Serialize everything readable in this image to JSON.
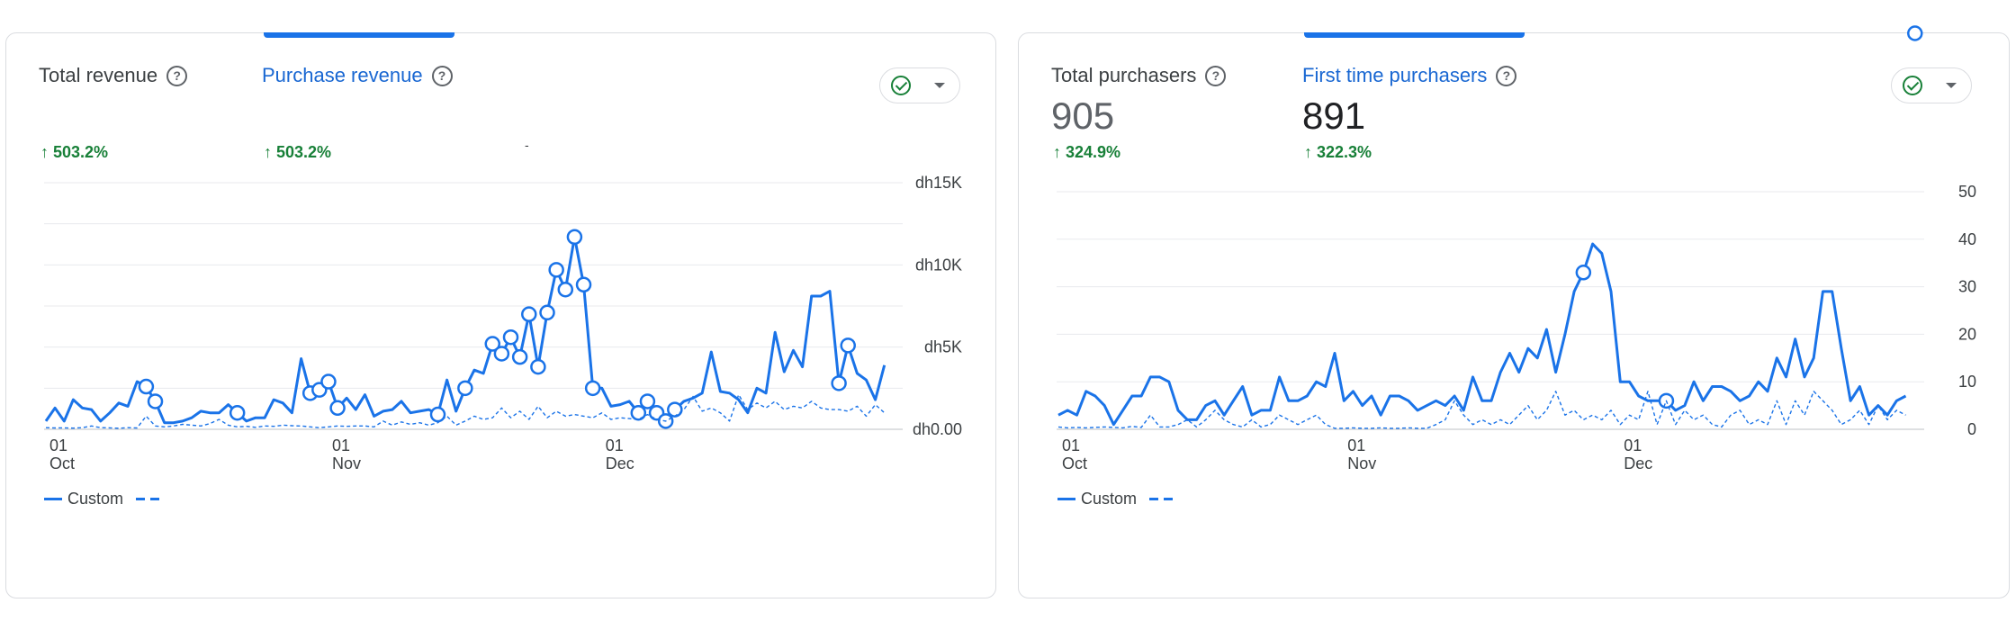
{
  "cards": [
    {
      "metrics": [
        {
          "label": "Total revenue",
          "value": "",
          "change": "503.2%"
        },
        {
          "label": "Purchase revenue",
          "value": "",
          "change": "503.2%"
        }
      ],
      "dash": "-",
      "legend": {
        "label": "Custom"
      }
    },
    {
      "metrics": [
        {
          "label": "Total purchasers",
          "value": "905",
          "change": "324.9%"
        },
        {
          "label": "First time purchasers",
          "value": "891",
          "change": "322.3%"
        }
      ],
      "dash": "",
      "legend": {
        "label": "Custom"
      }
    }
  ],
  "colors": {
    "series": "#1a73e8",
    "positive": "#188038",
    "grid": "#e8eaed"
  },
  "icons": {
    "help": "help-circle-icon",
    "status": "check-circle-icon",
    "dropdown": "caret-down-icon"
  },
  "chart_data": [
    {
      "type": "line",
      "ylim": [
        0,
        15000
      ],
      "y_ticks": [
        "dh0.00",
        "dh5K",
        "dh10K",
        "dh15K"
      ],
      "y_tick_values": [
        0,
        5000,
        10000,
        15000
      ],
      "x_ticks": [
        {
          "day": 1,
          "label": "01",
          "sub": "Oct"
        },
        {
          "day": 32,
          "label": "01",
          "sub": "Nov"
        },
        {
          "day": 62,
          "label": "01",
          "sub": "Dec"
        }
      ],
      "x_domain": [
        1,
        95
      ],
      "series": [
        {
          "name": "Custom",
          "style": "solid",
          "values": [
            500,
            1300,
            500,
            1800,
            1300,
            1200,
            500,
            1000,
            1600,
            1400,
            2900,
            2600,
            1700,
            400,
            400,
            500,
            700,
            1100,
            1000,
            1000,
            1500,
            1000,
            500,
            700,
            700,
            1800,
            1600,
            1000,
            4300,
            2200,
            2400,
            2900,
            1300,
            1900,
            1200,
            2100,
            800,
            1100,
            1200,
            1700,
            1000,
            1100,
            1200,
            900,
            3000,
            1100,
            2500,
            3600,
            3400,
            5200,
            4600,
            5600,
            4400,
            7000,
            3800,
            7100,
            9700,
            8500,
            11700,
            8800,
            2500,
            2500,
            1400,
            1500,
            1700,
            1000,
            1700,
            1000,
            500,
            1200,
            1700,
            1900,
            2200,
            4700,
            2300,
            2200,
            1800,
            1000,
            2500,
            2200,
            5900,
            3500,
            4800,
            3800,
            8100,
            8100,
            8400,
            2800,
            5100,
            3400,
            3000,
            1800,
            3900
          ],
          "markers": [
            11,
            12,
            21,
            29,
            30,
            31,
            32,
            43,
            46,
            49,
            50,
            51,
            52,
            53,
            54,
            55,
            56,
            57,
            58,
            59,
            60,
            65,
            66,
            67,
            68,
            69,
            87,
            88
          ]
        },
        {
          "name": "",
          "style": "dashed",
          "values": [
            100,
            80,
            90,
            70,
            100,
            200,
            100,
            90,
            60,
            100,
            80,
            800,
            200,
            150,
            200,
            300,
            250,
            200,
            350,
            600,
            250,
            150,
            180,
            120,
            200,
            180,
            250,
            220,
            200,
            150,
            100,
            150,
            200,
            180,
            200,
            200,
            150,
            500,
            250,
            450,
            300,
            400,
            250,
            400,
            800,
            250,
            500,
            800,
            600,
            700,
            1300,
            700,
            1100,
            600,
            1400,
            700,
            1100,
            800,
            900,
            800,
            700,
            1000,
            600,
            700,
            650,
            600,
            900,
            600,
            500,
            800,
            1200,
            2000,
            1100,
            1300,
            1000,
            500,
            2100,
            1200,
            1600,
            1300,
            1700,
            1200,
            1400,
            1300,
            1700,
            1300,
            1200,
            1200,
            1100,
            1400,
            800,
            1500,
            1000
          ]
        }
      ]
    },
    {
      "type": "line",
      "ylim": [
        0,
        50
      ],
      "y_ticks": [
        "0",
        "10",
        "20",
        "30",
        "40",
        "50"
      ],
      "y_tick_values": [
        0,
        10,
        20,
        30,
        40,
        50
      ],
      "x_ticks": [
        {
          "day": 1,
          "label": "01",
          "sub": "Oct"
        },
        {
          "day": 32,
          "label": "01",
          "sub": "Nov"
        },
        {
          "day": 62,
          "label": "01",
          "sub": "Dec"
        }
      ],
      "x_domain": [
        1,
        95
      ],
      "series": [
        {
          "name": "Custom",
          "style": "solid",
          "values": [
            3,
            4,
            3,
            8,
            7,
            5,
            1,
            4,
            7,
            7,
            11,
            11,
            10,
            4,
            2,
            2,
            5,
            6,
            3,
            6,
            9,
            3,
            4,
            4,
            11,
            6,
            6,
            7,
            10,
            9,
            16,
            6,
            8,
            5,
            7,
            3,
            7,
            7,
            6,
            4,
            5,
            6,
            5,
            7,
            4,
            11,
            6,
            6,
            12,
            16,
            12,
            17,
            15,
            21,
            12,
            20,
            29,
            33,
            39,
            37,
            29,
            10,
            10,
            7,
            6,
            6,
            6,
            4,
            5,
            10,
            6,
            9,
            9,
            8,
            6,
            7,
            10,
            8,
            15,
            11,
            19,
            11,
            15,
            29,
            29,
            17,
            6,
            9,
            3,
            5,
            3,
            6,
            7
          ],
          "markers": [
            57,
            66,
            93
          ]
        },
        {
          "name": "",
          "style": "dashed",
          "values": [
            0.5,
            0.3,
            0.4,
            0.3,
            0.4,
            0.5,
            0.4,
            0.3,
            0.6,
            0.4,
            3,
            0.5,
            0.5,
            1,
            2,
            0.5,
            2,
            4,
            2,
            1,
            0.5,
            2,
            0.5,
            1,
            3,
            2,
            1,
            2,
            3,
            1,
            0.2,
            0.2,
            0.3,
            0.2,
            0.2,
            0.3,
            0.2,
            0.2,
            0.3,
            0.2,
            0.2,
            1,
            2,
            6,
            3,
            1,
            2,
            1,
            2,
            1,
            3,
            5,
            2,
            4,
            8,
            3,
            4,
            2,
            3,
            2,
            4,
            1,
            3,
            2,
            8,
            1,
            6,
            1,
            4,
            2,
            3,
            1,
            0.5,
            3,
            4,
            1,
            2,
            1,
            6,
            1,
            6,
            3,
            8,
            6,
            4,
            1,
            2,
            4,
            1,
            5,
            2,
            4,
            3
          ]
        }
      ]
    }
  ]
}
